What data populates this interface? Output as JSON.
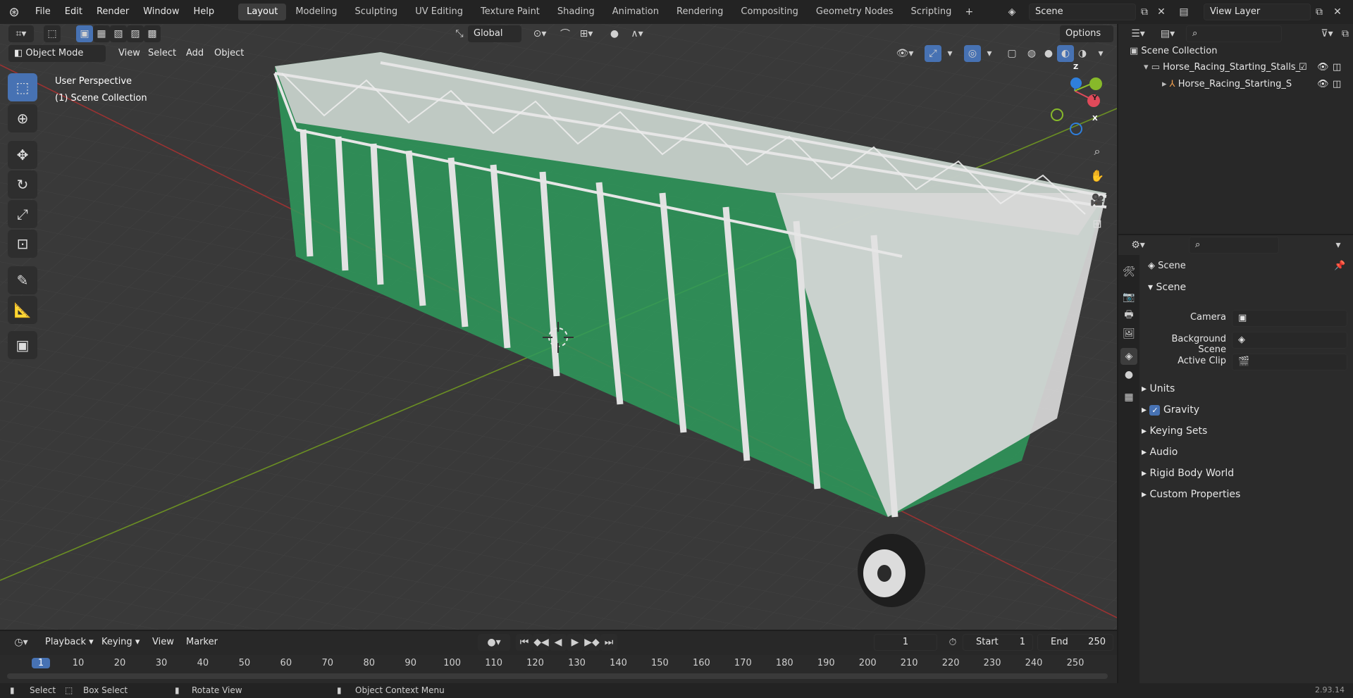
{
  "app": {
    "logo_icon": "blender-logo-icon",
    "version": "2.93.14"
  },
  "menu": [
    "File",
    "Edit",
    "Render",
    "Window",
    "Help"
  ],
  "workspaces": [
    {
      "label": "Layout",
      "active": true
    },
    {
      "label": "Modeling"
    },
    {
      "label": "Sculpting"
    },
    {
      "label": "UV Editing"
    },
    {
      "label": "Texture Paint"
    },
    {
      "label": "Shading"
    },
    {
      "label": "Animation"
    },
    {
      "label": "Rendering"
    },
    {
      "label": "Compositing"
    },
    {
      "label": "Geometry Nodes"
    },
    {
      "label": "Scripting"
    }
  ],
  "scene_field": "Scene",
  "view_layer_field": "View Layer",
  "viewport": {
    "transform_orientation": "Global",
    "options_label": "Options",
    "mode": "Object Mode",
    "header_menus": [
      "View",
      "Select",
      "Add",
      "Object"
    ],
    "overlay_title": "User Perspective",
    "overlay_subtitle": "(1) Scene Collection",
    "gizmo_axes": {
      "x": "X",
      "y": "Y",
      "z": "Z"
    }
  },
  "outliner": {
    "root": "Scene Collection",
    "items": [
      {
        "label": "Horse_Racing_Starting_Stalls_"
      },
      {
        "label": "Horse_Racing_Starting_S"
      }
    ]
  },
  "properties": {
    "context_label": "Scene",
    "panel_title": "Scene",
    "fields": [
      {
        "label": "Camera",
        "value": ""
      },
      {
        "label": "Background Scene",
        "value": ""
      },
      {
        "label": "Active Clip",
        "value": ""
      }
    ],
    "subpanels": [
      "Units",
      "Gravity",
      "Keying Sets",
      "Audio",
      "Rigid Body World",
      "Custom Properties"
    ]
  },
  "timeline": {
    "menus": [
      "Playback",
      "Keying",
      "View",
      "Marker"
    ],
    "current_frame": "1",
    "start_label": "Start",
    "start_value": "1",
    "end_label": "End",
    "end_value": "250",
    "ruler": [
      "1",
      "10",
      "20",
      "30",
      "40",
      "50",
      "60",
      "70",
      "80",
      "90",
      "100",
      "110",
      "120",
      "130",
      "140",
      "150",
      "160",
      "170",
      "180",
      "190",
      "200",
      "210",
      "220",
      "230",
      "240",
      "250"
    ]
  },
  "statusbar": {
    "select": "Select",
    "box_select": "Box Select",
    "rotate_view": "Rotate View",
    "context_menu": "Object Context Menu"
  },
  "colors": {
    "accent": "#4772b3",
    "grid_x": "#9b3232",
    "grid_y": "#6b8f23",
    "model_green": "#2e9a5c",
    "model_white": "#d8d8d8"
  }
}
